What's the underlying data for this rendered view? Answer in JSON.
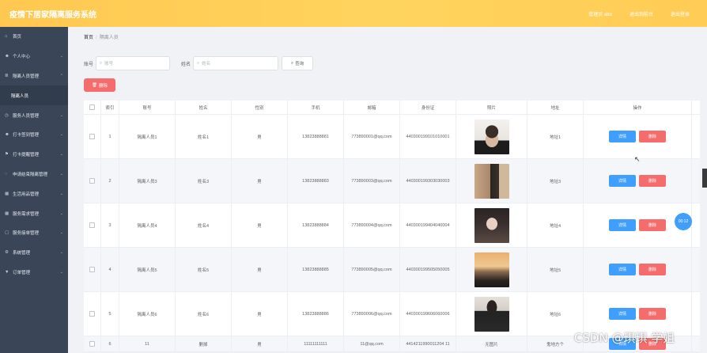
{
  "header": {
    "title": "疫情下居家隔离服务系统",
    "links": [
      "管理员 abo",
      "退出到前台",
      "退出登录"
    ]
  },
  "sidebar": {
    "items": [
      {
        "label": "首页",
        "icon": "home-icon",
        "chevron": false,
        "sub": false
      },
      {
        "label": "个人中心",
        "icon": "user-icon",
        "chevron": true,
        "sub": false
      },
      {
        "label": "隔离人员管理",
        "icon": "list-icon",
        "chevron": true,
        "sub": false
      },
      {
        "label": "隔离人员",
        "icon": "",
        "chevron": false,
        "sub": true
      },
      {
        "label": "服务人员管理",
        "icon": "clock-icon",
        "chevron": true,
        "sub": false
      },
      {
        "label": "打卡签到管理",
        "icon": "user-icon",
        "chevron": true,
        "sub": false
      },
      {
        "label": "打卡提醒管理",
        "icon": "flag-icon",
        "chevron": true,
        "sub": false
      },
      {
        "label": "申请结束隔离管理",
        "icon": "chat-icon",
        "chevron": true,
        "sub": false
      },
      {
        "label": "生活用品管理",
        "icon": "grid-icon",
        "chevron": true,
        "sub": false
      },
      {
        "label": "服务需求管理",
        "icon": "grid-icon",
        "chevron": true,
        "sub": false
      },
      {
        "label": "服务接单管理",
        "icon": "box-icon",
        "chevron": true,
        "sub": false
      },
      {
        "label": "系统管理",
        "icon": "gear-icon",
        "chevron": true,
        "sub": false
      },
      {
        "label": "订单管理",
        "icon": "cart-icon",
        "chevron": true,
        "sub": false
      }
    ]
  },
  "breadcrumb": {
    "home": "首页",
    "sep": "/",
    "current": "隔离人员"
  },
  "search": {
    "account_label": "账号",
    "account_placeholder": "账号",
    "name_label": "姓名",
    "name_placeholder": "姓名",
    "button": "查询"
  },
  "delete_button": "删除",
  "table": {
    "columns": [
      "索引",
      "账号",
      "姓名",
      "性别",
      "手机",
      "邮箱",
      "身份证",
      "照片",
      "地址",
      "操作"
    ],
    "detail_label": "详情",
    "delete_label": "删除",
    "rows": [
      {
        "index": "1",
        "account": "隔离人员1",
        "name": "姓名1",
        "gender": "男",
        "phone": "13823888881",
        "email": "773890001@qq.com",
        "id": "440300199101010001",
        "photo": "photo-person-1",
        "address": "地址1"
      },
      {
        "index": "2",
        "account": "隔离人员3",
        "name": "姓名3",
        "gender": "男",
        "phone": "13823888883",
        "email": "773890003@qq.com",
        "id": "440300199303030003",
        "photo": "photo-person-3",
        "address": "地址3"
      },
      {
        "index": "3",
        "account": "隔离人员4",
        "name": "姓名4",
        "gender": "男",
        "phone": "13823888884",
        "email": "773890004@qq.com",
        "id": "440300199404040004",
        "photo": "photo-person-4",
        "address": "地址4"
      },
      {
        "index": "4",
        "account": "隔离人员5",
        "name": "姓名5",
        "gender": "男",
        "phone": "13823888885",
        "email": "773890005@qq.com",
        "id": "440300199505050005",
        "photo": "photo-person-5",
        "address": "地址5"
      },
      {
        "index": "5",
        "account": "隔离人员6",
        "name": "姓名6",
        "gender": "男",
        "phone": "13823888886",
        "email": "773890006@qq.com",
        "id": "440300199606060006",
        "photo": "photo-person-6",
        "address": "地址6"
      }
    ],
    "partial_row": {
      "index": "6",
      "account": "11",
      "name": "删掉",
      "gender": "男",
      "phone": "11111111111",
      "email": "11@qq.com",
      "id": "4414211990011204 11",
      "photo_text": "无图片",
      "address": "鬼地方个"
    }
  },
  "timer": "00:12",
  "watermark": "CSDN @琪琪 学姐"
}
